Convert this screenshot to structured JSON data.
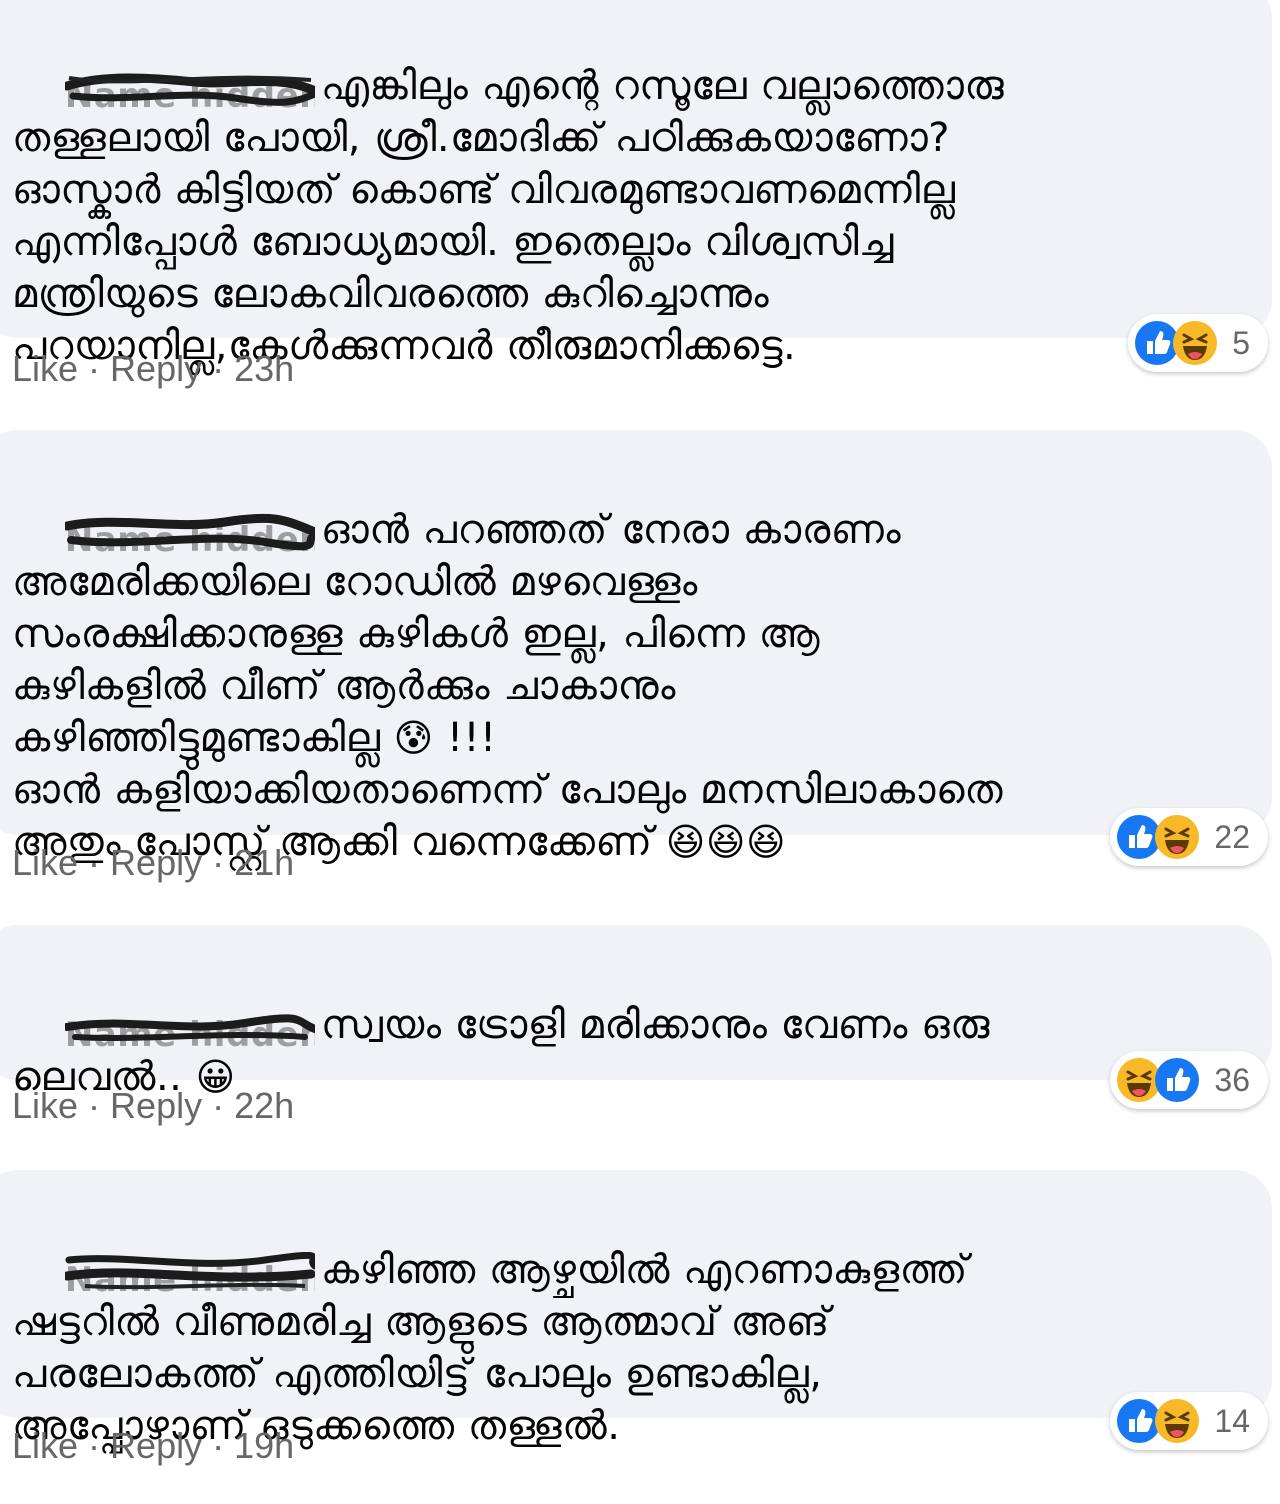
{
  "comments": [
    {
      "author": "Name hidden",
      "text": "എങ്കിലും എന്റെ റസൂലേ വല്ലാത്തൊരു\nതള്ളലായി പോയി, ശ്രീ.മോദിക്ക് പഠിക്കുകയാണോ?\nഓസ്കാർ കിട്ടിയത് കൊണ്ട് വിവരമുണ്ടാവണമെന്നില്ല\nഎന്നിപ്പോൾ ബോധ്യമായി. ഇതെല്ലാം വിശ്വസിച്ച\nമന്ത്രിയുടെ ലോകവിവരത്തെ കുറിച്ചൊന്നും\nപറയാനില്ല,കേൾക്കുന്നവർ തീരുമാനിക്കട്ടെ.",
      "like_label": "Like",
      "reply_label": "Reply",
      "time": "23h",
      "reaction_count": "5",
      "reaction_icons": [
        "like-icon",
        "haha-icon"
      ]
    },
    {
      "author": "Name hidden",
      "text": "ഓൻ പറഞ്ഞത് നേരാ കാരണം\nഅമേരിക്കയിലെ റോഡിൽ മഴവെള്ളം\nസംരക്ഷിക്കാനുള്ള കുഴികൾ ഇല്ല, പിന്നെ ആ\nകുഴികളിൽ വീണ് ആർക്കും ചാകാനും\nകഴിഞ്ഞിട്ടുമുണ്ടാകില്ല",
      "text_emoji": "😰",
      "text_suffix": " !!!\nഓൻ കളിയാക്കിയതാണെന്ന് പോലും മനസിലാകാതെ\nഅതും പോസ്റ്റ് ആക്കി വന്നെക്കേണ് ",
      "text_end_emoji": "😆😆😆",
      "like_label": "Like",
      "reply_label": "Reply",
      "time": "21h",
      "reaction_count": "22",
      "reaction_icons": [
        "like-icon",
        "haha-icon"
      ]
    },
    {
      "author": "Name hidden",
      "text": "സ്വയം ട്രോളി മരിക്കാനും വേണം ഒരു\nലെവൽ.. ",
      "text_end_emoji": "😀",
      "like_label": "Like",
      "reply_label": "Reply",
      "time": "22h",
      "reaction_count": "36",
      "reaction_icons": [
        "haha-icon",
        "like-icon"
      ]
    },
    {
      "author": "Name hidden",
      "text": "കഴിഞ്ഞ ആഴ്ചയിൽ എറണാകുളത്ത്\nഷട്ടറിൽ വീണുമരിച്ച ആളുടെ ആത്മാവ് അങ്\nപരലോകത്ത് എത്തിയിട്ട് പോലും ഉണ്ടാകില്ല,\nഅപ്പോഴാണ് ഒടുക്കത്തെ തള്ളൽ.",
      "like_label": "Like",
      "reply_label": "Reply",
      "time": "19h",
      "reaction_count": "14",
      "reaction_icons": [
        "like-icon",
        "haha-icon"
      ]
    }
  ],
  "colors": {
    "bubble": "#f0f2f5",
    "meta_text": "#65676b",
    "like_blue": "#1877f2",
    "haha_yellow": "#f7b928"
  }
}
